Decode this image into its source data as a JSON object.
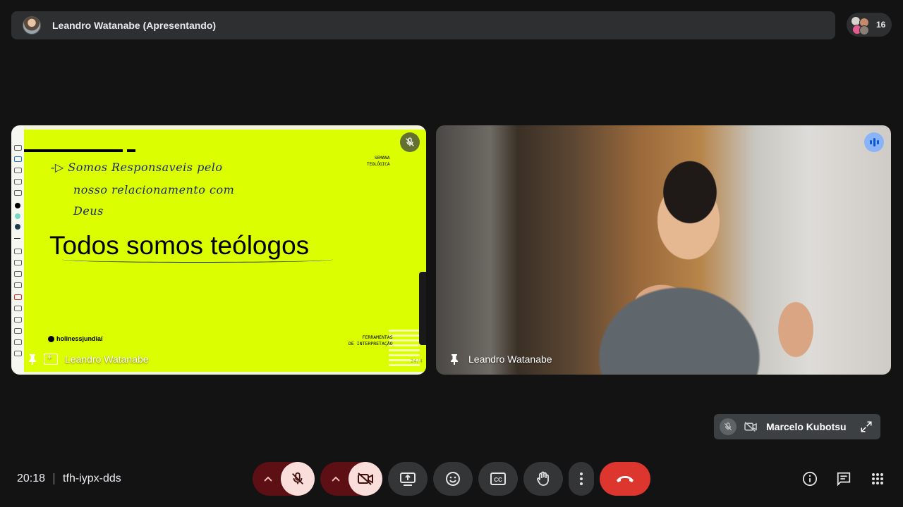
{
  "header": {
    "presenting_label": "Leandro Watanabe (Apresentando)",
    "participant_count": "16"
  },
  "screen_share": {
    "handwritten_lines": [
      "-▷ Somos  Responsaveis  pelo",
      "nosso  relacionamento  com",
      "Deus"
    ],
    "heading": "Todos somos teólogos",
    "corner_text_1": "SEMANA",
    "corner_text_2": "TEOLÓGICA",
    "bottom_text_1": "FERRAMENTAS",
    "bottom_text_2": "DE INTERPRETAÇÃO",
    "logo_text": "holinessjundiaí",
    "page_number": "24/4",
    "tile_name": "Leandro Watanabe"
  },
  "camera": {
    "tile_name": "Leandro Watanabe"
  },
  "self_view": {
    "name": "Marcelo Kubotsu"
  },
  "meeting": {
    "time": "20:18",
    "code": "tfh-iypx-dds"
  },
  "colors": {
    "slide_bg": "#dcff00",
    "leave": "#dc362e",
    "muted_bg": "#f9dedc",
    "speaking": "#8ab4f8"
  }
}
